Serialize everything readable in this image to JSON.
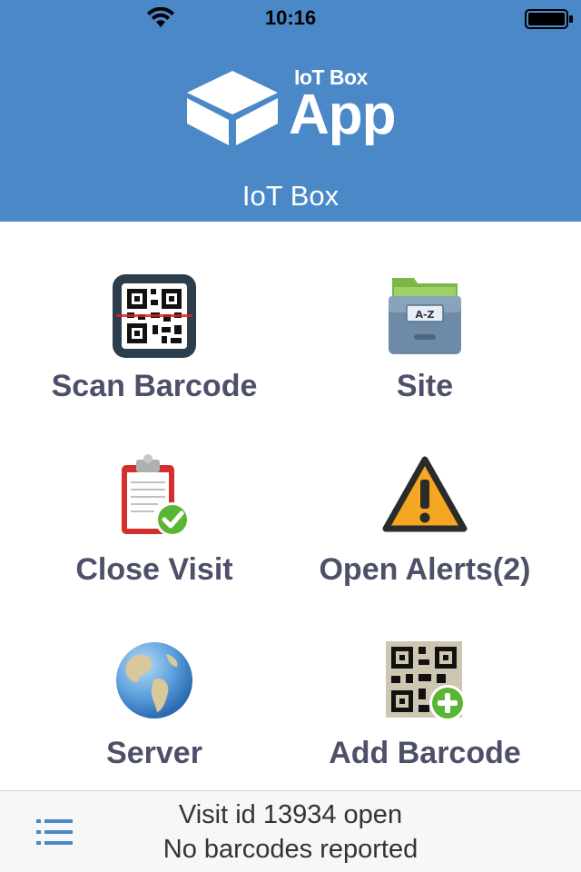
{
  "status_bar": {
    "time": "10:16"
  },
  "header": {
    "logo_small_text": "IoT Box",
    "logo_large_text": "App",
    "title": "IoT Box"
  },
  "tiles": [
    {
      "label": "Scan Barcode",
      "icon": "qr-scanner-icon"
    },
    {
      "label": "Site",
      "icon": "file-cabinet-icon"
    },
    {
      "label": "Close Visit",
      "icon": "clipboard-check-icon"
    },
    {
      "label": "Open Alerts(2)",
      "icon": "warning-icon"
    },
    {
      "label": "Server",
      "icon": "globe-icon"
    },
    {
      "label": "Add Barcode",
      "icon": "qr-add-icon"
    }
  ],
  "footer": {
    "line1": "Visit id 13934 open",
    "line2": "No barcodes reported"
  },
  "colors": {
    "header_bg": "#4a88c7",
    "label_text": "#4d5068",
    "footer_bg": "#f7f7f7",
    "menu_icon": "#4a88c7"
  },
  "site_drawer_label": "A-Z"
}
